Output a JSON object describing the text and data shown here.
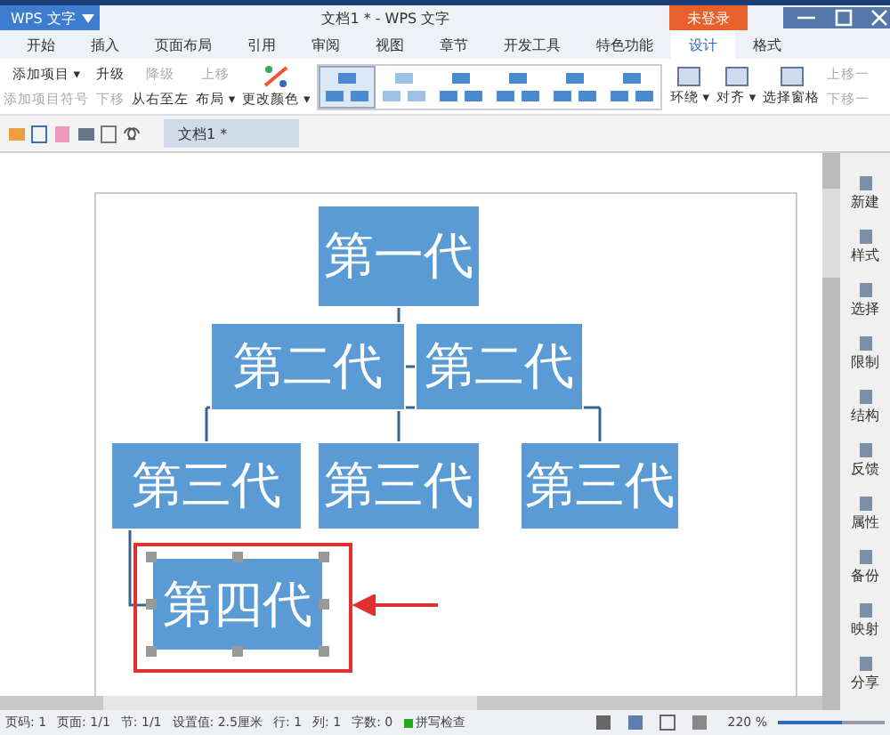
{
  "title_bar": {
    "app_menu": "WPS 文字",
    "title": "文档1 * - WPS 文字",
    "login": "未登录"
  },
  "tabs": [
    {
      "label": "开始",
      "selected": false
    },
    {
      "label": "插入",
      "selected": false
    },
    {
      "label": "页面布局",
      "selected": false
    },
    {
      "label": "引用",
      "selected": false
    },
    {
      "label": "审阅",
      "selected": false
    },
    {
      "label": "视图",
      "selected": false
    },
    {
      "label": "章节",
      "selected": false
    },
    {
      "label": "开发工具",
      "selected": false
    },
    {
      "label": "特色功能",
      "selected": false
    },
    {
      "label": "设计",
      "selected": true
    },
    {
      "label": "格式",
      "selected": false
    }
  ],
  "ribbon": {
    "left": [
      {
        "label": "添加项目 ▾",
        "disabled": false
      },
      {
        "label": "添加项目符号",
        "disabled": true
      }
    ],
    "middle": [
      {
        "label": "升级",
        "disabled": false
      },
      {
        "label": "降级",
        "disabled": true
      },
      {
        "label": "上移",
        "disabled": true
      },
      {
        "label": "下移",
        "disabled": true
      },
      {
        "label": "从右至左",
        "disabled": false
      },
      {
        "label": "布局 ▾",
        "disabled": false
      }
    ],
    "color_button": "更改颜色 ▾",
    "layouts": [
      {
        "selected": true
      },
      {
        "selected": false
      },
      {
        "selected": false
      },
      {
        "selected": false
      },
      {
        "selected": false
      },
      {
        "selected": false
      }
    ],
    "right": [
      {
        "label": "环绕 ▾"
      },
      {
        "label": "对齐 ▾"
      },
      {
        "label": "选择窗格"
      }
    ],
    "order": [
      {
        "label": "上移一",
        "disabled": true
      },
      {
        "label": "下移一",
        "disabled": true
      }
    ]
  },
  "document_tab": {
    "label": "文档1 *",
    "selected": true
  },
  "org_chart": {
    "label": "第一代",
    "selected": false,
    "assistants": [
      {
        "label": "第二代",
        "selected": false
      },
      {
        "label": "第二代",
        "selected": false
      }
    ],
    "children": [
      {
        "label": "第三代",
        "selected": false,
        "children": [
          {
            "label": "第四代",
            "selected": true
          }
        ]
      },
      {
        "label": "第三代",
        "selected": false
      },
      {
        "label": "第三代",
        "selected": false
      }
    ]
  },
  "side_panel": [
    "新建",
    "样式",
    "选择",
    "限制",
    "结构",
    "反馈",
    "属性",
    "备份",
    "映射",
    "分享"
  ],
  "status_bar": {
    "items": [
      "页码: 1",
      "页面: 1/1",
      "节: 1/1",
      "设置值: 2.5厘米",
      "行: 1",
      "列: 1",
      "字数: 0"
    ],
    "spell_check": "拼写检查",
    "zoom": "220 %",
    "zoom_slider": {
      "level": 0.6
    }
  }
}
